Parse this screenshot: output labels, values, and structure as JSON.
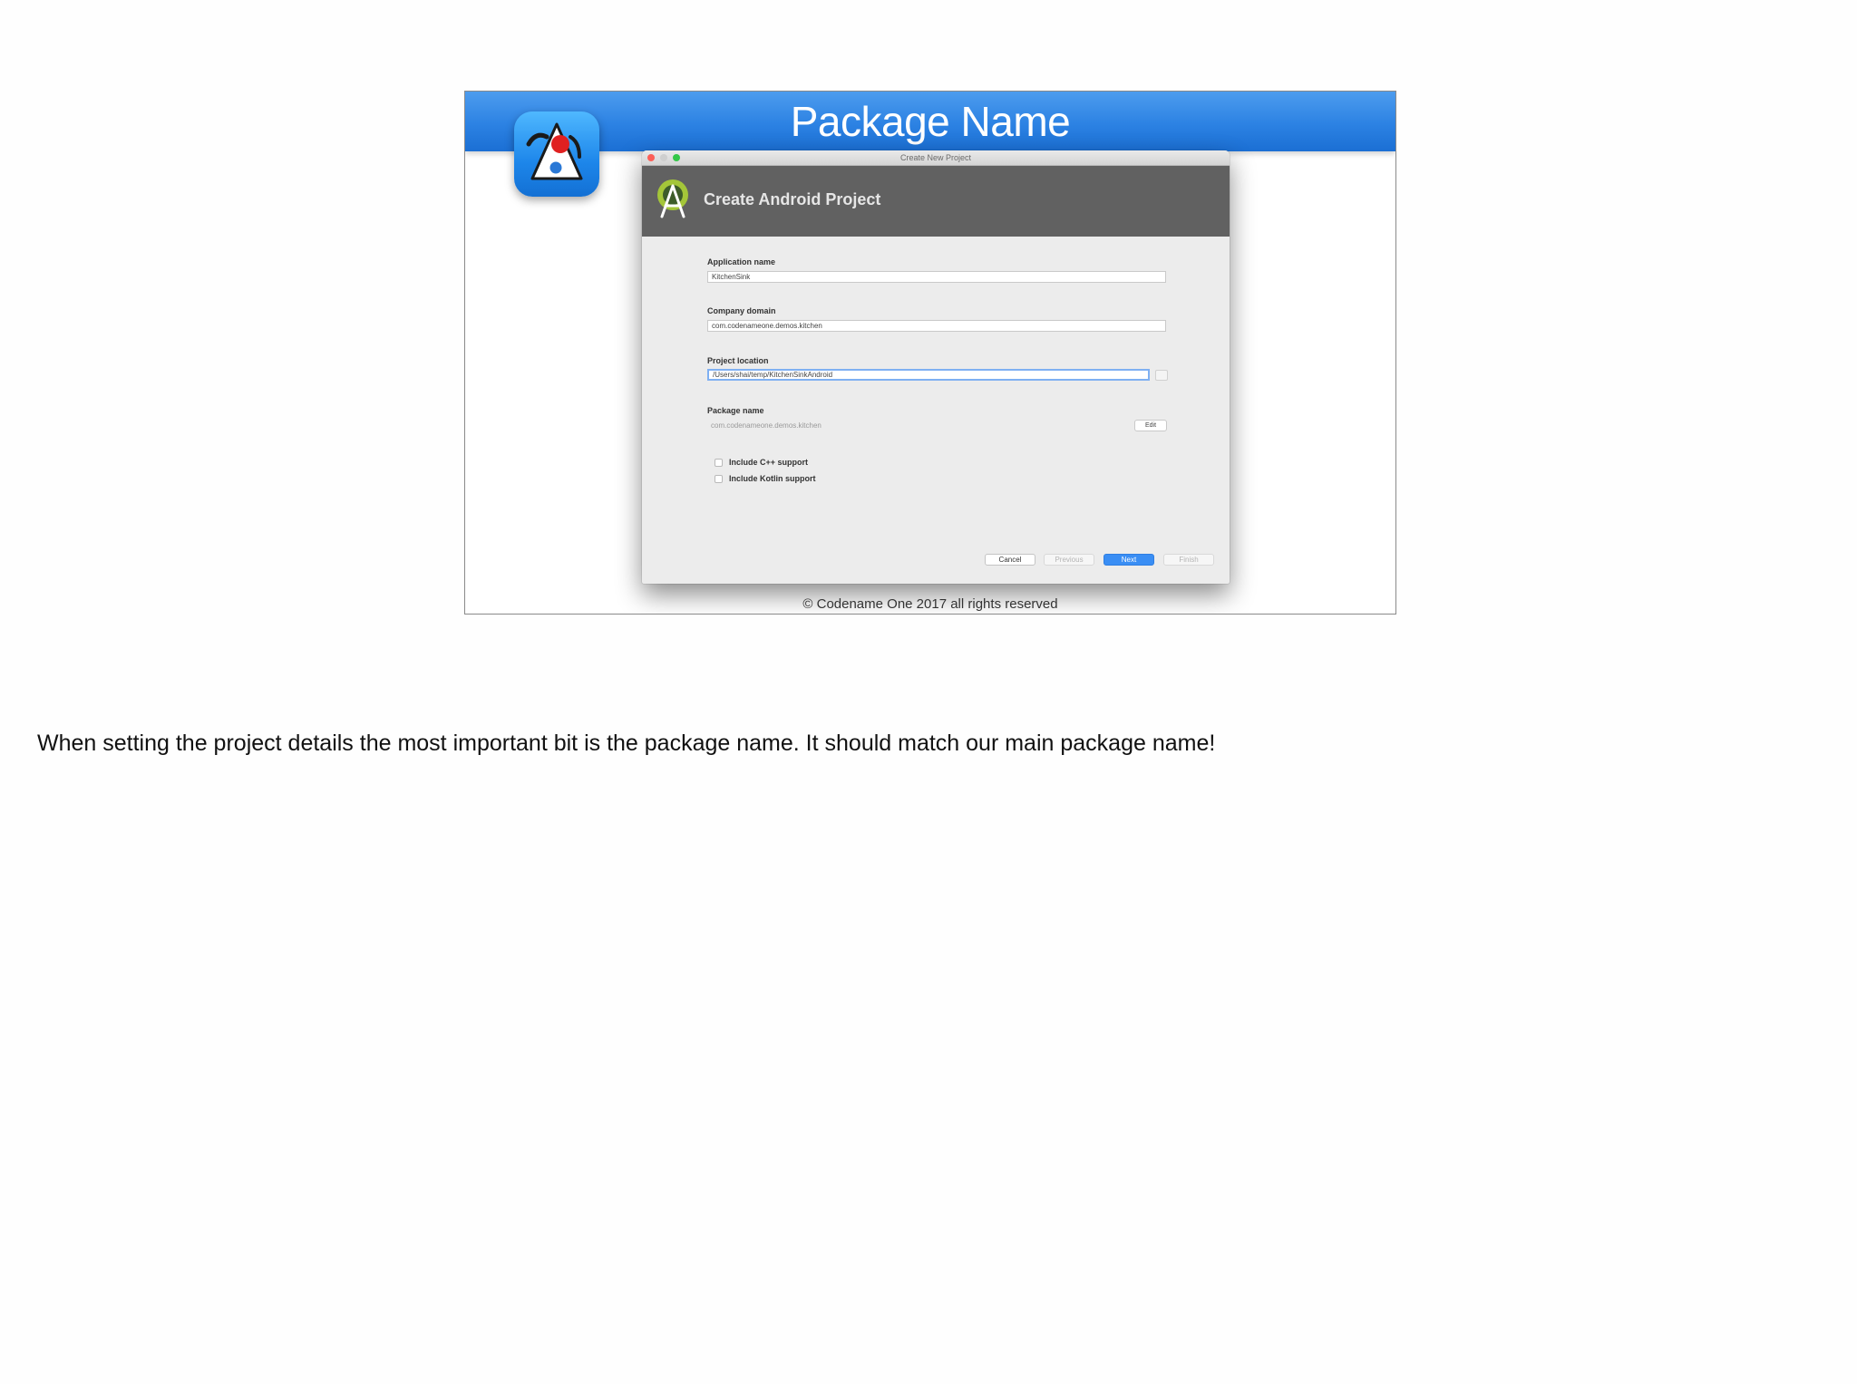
{
  "slide": {
    "title": "Package Name",
    "footer": "© Codename One 2017 all rights reserved"
  },
  "dialog": {
    "window_title": "Create New Project",
    "banner_title": "Create Android Project",
    "fields": {
      "application_name": {
        "label": "Application name",
        "value": "KitchenSink"
      },
      "company_domain": {
        "label": "Company domain",
        "value": "com.codenameone.demos.kitchen"
      },
      "project_location": {
        "label": "Project location",
        "value": "/Users/shai/temp/KitchenSinkAndroid"
      },
      "package_name": {
        "label": "Package name",
        "value": "com.codenameone.demos.kitchen",
        "edit_label": "Edit"
      }
    },
    "checkboxes": [
      {
        "label": "Include C++ support",
        "checked": false
      },
      {
        "label": "Include Kotlin support",
        "checked": false
      }
    ],
    "buttons": {
      "cancel": "Cancel",
      "previous": "Previous",
      "next": "Next",
      "finish": "Finish"
    }
  },
  "notes": {
    "text": "When setting the project details the most important bit is the package name. It should match our main package name!"
  },
  "colors": {
    "header_blue": "#2c82e3",
    "banner_gray": "#616161",
    "primary_button": "#3a8ef4",
    "android_green": "#a4c639"
  }
}
